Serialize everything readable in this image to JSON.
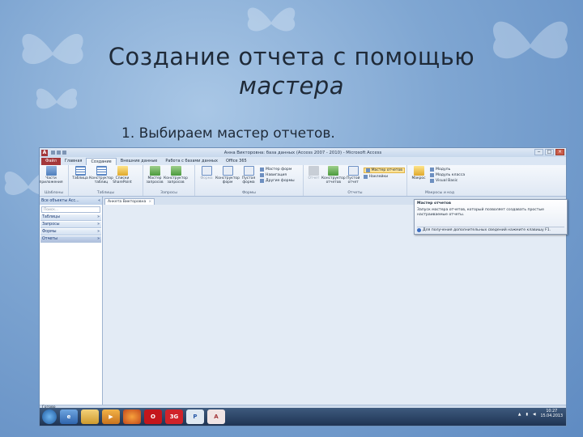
{
  "slide": {
    "title_line1": "Создание отчета с помощью",
    "title_line2": "мастера",
    "subtitle": "1. Выбираем мастер отчетов."
  },
  "window": {
    "app_icon": "A",
    "title": "Анна Викторовна: база данных (Access 2007 - 2010) - Microsoft Access",
    "controls": [
      "‒",
      "□",
      "×"
    ]
  },
  "tabs": [
    "Файл",
    "Главная",
    "Создание",
    "Внешние данные",
    "Работа с базами данных",
    "Office 365"
  ],
  "ribbon": {
    "templates": {
      "label": "Шаблоны",
      "buttons": [
        "Части приложения"
      ]
    },
    "tables": {
      "label": "Таблицы",
      "buttons": [
        "Таблица",
        "Конструктор таблиц",
        "Списки SharePoint"
      ]
    },
    "queries": {
      "label": "Запросы",
      "buttons": [
        "Мастер запросов",
        "Конструктор запросов"
      ]
    },
    "forms": {
      "label": "Формы",
      "buttons": [
        "Форма",
        "Конструктор форм",
        "Пустая форма"
      ],
      "small": [
        "Мастер форм",
        "Навигация",
        "Другие формы"
      ]
    },
    "reports": {
      "label": "Отчеты",
      "buttons": [
        "Отчет",
        "Конструктор отчетов",
        "Пустой отчет"
      ],
      "small": [
        "Мастер отчетов",
        "Наклейки"
      ]
    },
    "macros": {
      "label": "Макросы и код",
      "buttons": [
        "Макрос"
      ],
      "small": [
        "Модуль",
        "Модуль класса",
        "Visual Basic"
      ]
    }
  },
  "nav": {
    "header": "Все объекты Acc...",
    "search_placeholder": "Поиск...",
    "items": [
      "Таблицы",
      "Запросы",
      "Формы",
      "Отчеты"
    ]
  },
  "doc": {
    "tab_label": "Анкета Викторовна",
    "tab_close": "×"
  },
  "tooltip": {
    "title": "Мастер отчетов",
    "body": "Запуск мастера отчетов, который позволяет создавать простые настраиваемые отчеты.",
    "help": "Для получения дополнительных сведений нажмите клавишу F1."
  },
  "status": {
    "text": "Готово"
  },
  "taskbar": {
    "apps": [
      "start",
      "ie",
      "explorer",
      "media",
      "firefox",
      "opera",
      "3G",
      "publisher",
      "access"
    ],
    "app_labels": {
      "opera": "O",
      "3g": "3G",
      "pub": "P",
      "acc": "A"
    },
    "time": "10:27",
    "date": "15.04.2013"
  },
  "colors": {
    "file_tab": "#a4373a",
    "background": "#7fa6d2",
    "highlight": "#fbe39a"
  }
}
